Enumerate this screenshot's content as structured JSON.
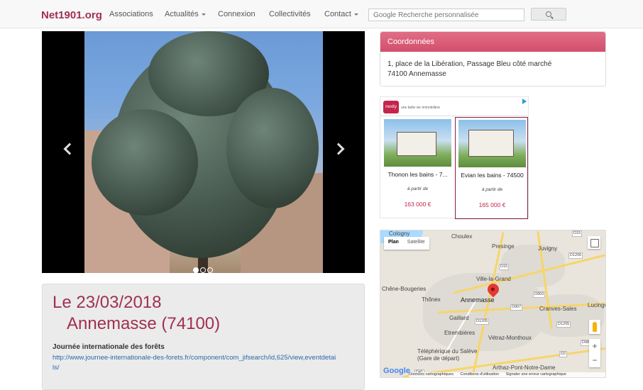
{
  "navbar": {
    "brand": "Net1901.org",
    "items": [
      {
        "label": "Associations",
        "dropdown": false
      },
      {
        "label": "Actualités",
        "dropdown": true
      },
      {
        "label": "Connexion",
        "dropdown": false
      },
      {
        "label": "Collectivités",
        "dropdown": false
      },
      {
        "label": "Contact",
        "dropdown": true
      }
    ],
    "search_placeholder": "Google Recherche personnalisée",
    "search_button_icon": "search-icon"
  },
  "carousel": {
    "image": "cedar-tree-photo",
    "slide_count": 3,
    "active_slide": 1,
    "prev_icon": "chevron-left-icon",
    "next_icon": "chevron-right-icon"
  },
  "event": {
    "date": "Le 23/03/2018",
    "city": "Annemasse (74100)",
    "title": "Journée internationale des forêts",
    "link": "http://www.journee-internationale-des-forets.fr/component/com_jifsearch/id,625/view,eventdetails/"
  },
  "coordonnees": {
    "heading": "Coordonnées",
    "address_line1": "1, place de la Libération, Passage Bleu côté marché",
    "address_line2": "74100 Annemasse"
  },
  "ad": {
    "brand": "nexity",
    "tagline": "une belle vie immobilière",
    "cards": [
      {
        "name": "Thonon les bains - 7...",
        "from": "à partir de",
        "price": "163 000 €"
      },
      {
        "name": "Evian les bains - 74500",
        "from": "à partir de",
        "price": "165 000 €"
      }
    ]
  },
  "map": {
    "type_plan": "Plan",
    "type_satellite": "Satellite",
    "places": {
      "cologny": "Cologny",
      "choulex": "Choulex",
      "presinge": "Presinge",
      "juvigny": "Juvigny",
      "ville_la_grand": "Ville-la-Grand",
      "chene_bougeries": "Chêne-Bougeries",
      "thonex": "Thônex",
      "annemasse": "Annemasse",
      "cranves_sales": "Cranves-Sales",
      "lucinges": "Lucinge",
      "gaillard": "Gaillard",
      "etrembieres": "Etrembières",
      "vetraz": "Vétraz-Monthoux",
      "teleferique": "Téléphérique du Salève",
      "gare": "(Gare de départ)",
      "arthaz": "Arthaz-Pont-Notre-Dame"
    },
    "road_shields": [
      "D15",
      "D1206",
      "D15",
      "D903",
      "D907",
      "D1205",
      "D1205",
      "D98",
      "D2",
      "D41"
    ],
    "google": "Google",
    "footer": {
      "data": "Données cartographiques",
      "terms": "Conditions d'utilisation",
      "report": "Signaler une erreur cartographique"
    }
  }
}
